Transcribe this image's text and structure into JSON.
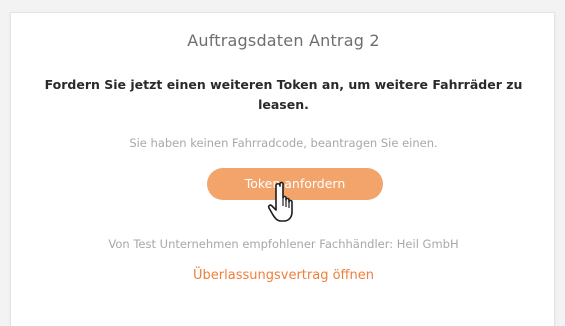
{
  "card": {
    "title": "Auftragsdaten Antrag 2",
    "headline": "Fordern Sie jetzt einen weiteren Token an, um weitere Fahrräder zu leasen.",
    "info_text": "Sie haben keinen Fahrradcode, beantragen Sie einen.",
    "token_button_label": "Token anfordern",
    "dealer_text": "Von Test Unternehmen empfohlener Fachhändler: Heil GmbH",
    "contract_link_label": "Überlassungsvertrag öffnen"
  },
  "colors": {
    "accent": "#f3a46b",
    "link": "#ee7f3a",
    "muted_text": "#a8a8a8",
    "title_text": "#6e6e6e"
  },
  "icons": {
    "cursor": "hand-pointer-icon"
  }
}
